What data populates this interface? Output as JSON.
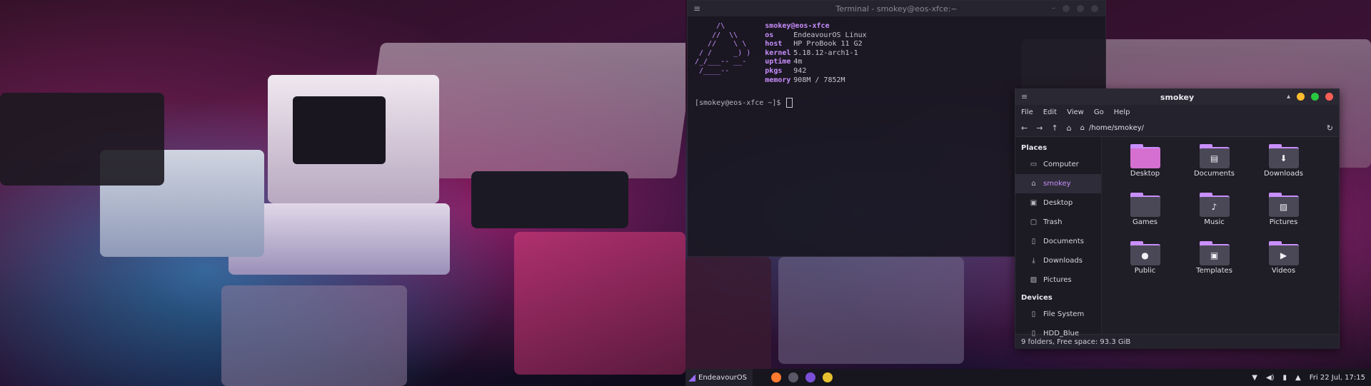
{
  "terminal": {
    "title": "Terminal - smokey@eos-xfce:~",
    "logo": "     /\\\n    //  \\\\\n   //    \\ \\\n / /     _) )\n/_/___-- __-\n /____--",
    "user": "smokey@eos-xfce",
    "info": [
      {
        "key": "os",
        "value": "EndeavourOS Linux"
      },
      {
        "key": "host",
        "value": "HP ProBook 11 G2"
      },
      {
        "key": "kernel",
        "value": "5.18.12-arch1-1"
      },
      {
        "key": "uptime",
        "value": "4m"
      },
      {
        "key": "pkgs",
        "value": "942"
      },
      {
        "key": "memory",
        "value": "908M / 7852M"
      }
    ],
    "prompt": "[smokey@eos-xfce ~]$"
  },
  "file_manager": {
    "title": "smokey",
    "menu": [
      "File",
      "Edit",
      "View",
      "Go",
      "Help"
    ],
    "path": "/home/smokey/",
    "places_header": "Places",
    "places": [
      "Computer",
      "smokey",
      "Desktop",
      "Trash",
      "Documents",
      "Downloads",
      "Pictures"
    ],
    "devices_header": "Devices",
    "devices": [
      "File System",
      "HDD_Blue"
    ],
    "folders": [
      "Desktop",
      "Documents",
      "Downloads",
      "Games",
      "Music",
      "Pictures",
      "Public",
      "Templates",
      "Videos"
    ],
    "status": "9 folders, Free space: 93.3 GiB",
    "colors": {
      "accent": "#c98fff",
      "close": "#ff5f57",
      "maximize": "#28c840",
      "minimize": "#febc2e"
    }
  },
  "taskbar": {
    "start_label": "EndeavourOS",
    "clock": "Fri 22 Jul, 17:15"
  }
}
